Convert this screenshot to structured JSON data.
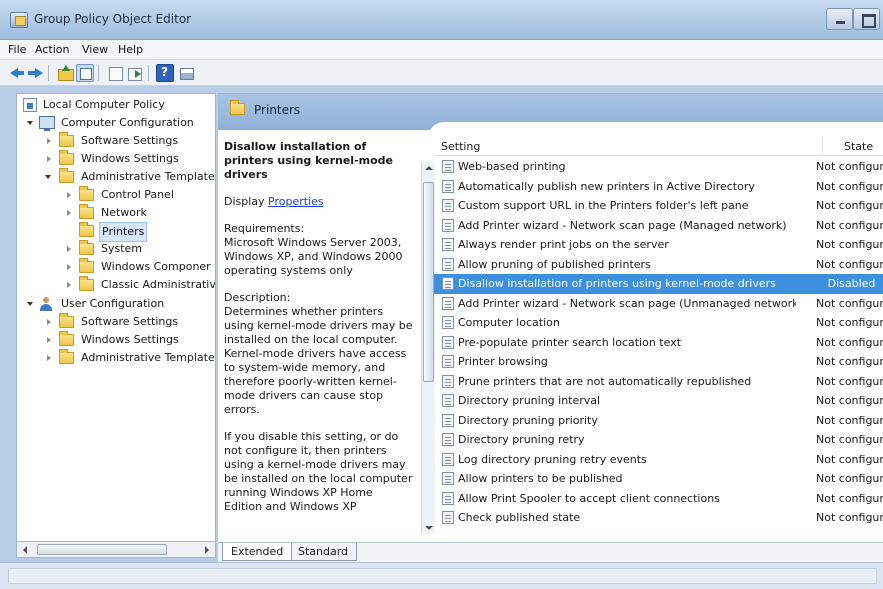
{
  "window": {
    "title": "Group Policy Object Editor"
  },
  "menu": [
    "File",
    "Action",
    "View",
    "Help"
  ],
  "tree": {
    "root": "Local Computer Policy",
    "computer_configuration": "Computer Configuration",
    "cc_software_settings": "Software Settings",
    "cc_windows_settings": "Windows Settings",
    "cc_admin_templates": "Administrative Template",
    "control_panel": "Control Panel",
    "network": "Network",
    "printers": "Printers",
    "system": "System",
    "windows_components": "Windows Componer",
    "classic_admin": "Classic Administrativ",
    "user_configuration": "User Configuration",
    "uc_software_settings": "Software Settings",
    "uc_windows_settings": "Windows Settings",
    "uc_admin_templates": "Administrative Template"
  },
  "details": {
    "folder_title": "Printers",
    "setting_title": "Disallow installation of printers using kernel-mode drivers",
    "display_label": "Display",
    "properties_link": "Properties",
    "requirements_label": "Requirements:",
    "requirements_text": "Microsoft Windows Server 2003, Windows XP, and Windows 2000 operating systems only",
    "description_label": "Description:",
    "description_text": "Determines whether printers using kernel-mode drivers may be installed on the local computer. Kernel-mode drivers have access to system-wide memory, and therefore poorly-written kernel-mode drivers can cause stop errors.",
    "description_text2": "If you disable this setting, or do not configure it, then printers using a kernel-mode drivers may be installed on the local computer running Windows XP Home Edition and Windows XP"
  },
  "list": {
    "col_setting": "Setting",
    "col_state": "State",
    "rows": [
      {
        "name": "Web-based printing",
        "state": "Not configured"
      },
      {
        "name": "Automatically publish new printers in Active Directory",
        "state": "Not configured"
      },
      {
        "name": "Custom support URL in the Printers folder's left pane",
        "state": "Not configured"
      },
      {
        "name": "Add Printer wizard - Network scan page (Managed network)",
        "state": "Not configured"
      },
      {
        "name": "Always render print jobs on the server",
        "state": "Not configured"
      },
      {
        "name": "Allow pruning of published printers",
        "state": "Not configured"
      },
      {
        "name": "Disallow installation of printers using kernel-mode drivers",
        "state": "Disabled"
      },
      {
        "name": "Add Printer wizard - Network scan page (Unmanaged network)",
        "state": "Not configured"
      },
      {
        "name": "Computer location",
        "state": "Not configured"
      },
      {
        "name": "Pre-populate printer search location text",
        "state": "Not configured"
      },
      {
        "name": "Printer browsing",
        "state": "Not configured"
      },
      {
        "name": "Prune printers that are not automatically republished",
        "state": "Not configured"
      },
      {
        "name": "Directory pruning interval",
        "state": "Not configured"
      },
      {
        "name": "Directory pruning priority",
        "state": "Not configured"
      },
      {
        "name": "Directory pruning retry",
        "state": "Not configured"
      },
      {
        "name": "Log directory pruning retry events",
        "state": "Not configured"
      },
      {
        "name": "Allow printers to be published",
        "state": "Not configured"
      },
      {
        "name": "Allow Print Spooler to accept client connections",
        "state": "Not configured"
      },
      {
        "name": "Check published state",
        "state": "Not configured"
      }
    ]
  },
  "tabs": {
    "extended": "Extended",
    "standard": "Standard"
  }
}
